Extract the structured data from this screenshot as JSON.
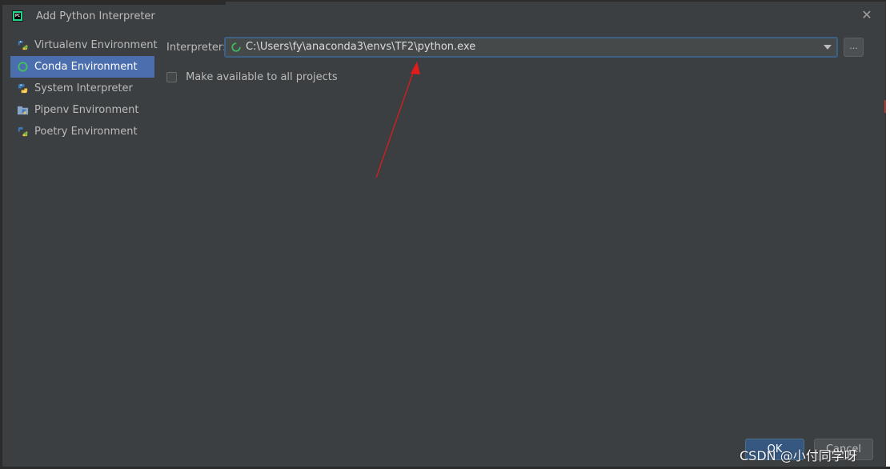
{
  "window": {
    "title": "Add Python Interpreter",
    "close_glyph": "✕"
  },
  "sidebar": {
    "items": [
      {
        "label": "Virtualenv Environment",
        "icon": "virtualenv-icon"
      },
      {
        "label": "Conda Environment",
        "icon": "conda-icon",
        "selected": true
      },
      {
        "label": "System Interpreter",
        "icon": "python-icon"
      },
      {
        "label": "Pipenv Environment",
        "icon": "pipenv-icon"
      },
      {
        "label": "Poetry Environment",
        "icon": "poetry-icon"
      }
    ]
  },
  "main": {
    "interpreter_label": "Interpreter:",
    "interpreter_value": "C:\\Users\\fy\\anaconda3\\envs\\TF2\\python.exe",
    "browse_label": "...",
    "make_available_label": "Make available to all projects",
    "make_available_checked": false
  },
  "footer": {
    "ok_label": "OK",
    "cancel_label": "Cancel"
  },
  "watermark": "CSDN @小付同学呀",
  "colors": {
    "background": "#3c3f41",
    "selection": "#4b6eaf",
    "focus_border": "#3d6185",
    "arrow": "#e31b1b",
    "spinner": "#3dbb5c"
  }
}
